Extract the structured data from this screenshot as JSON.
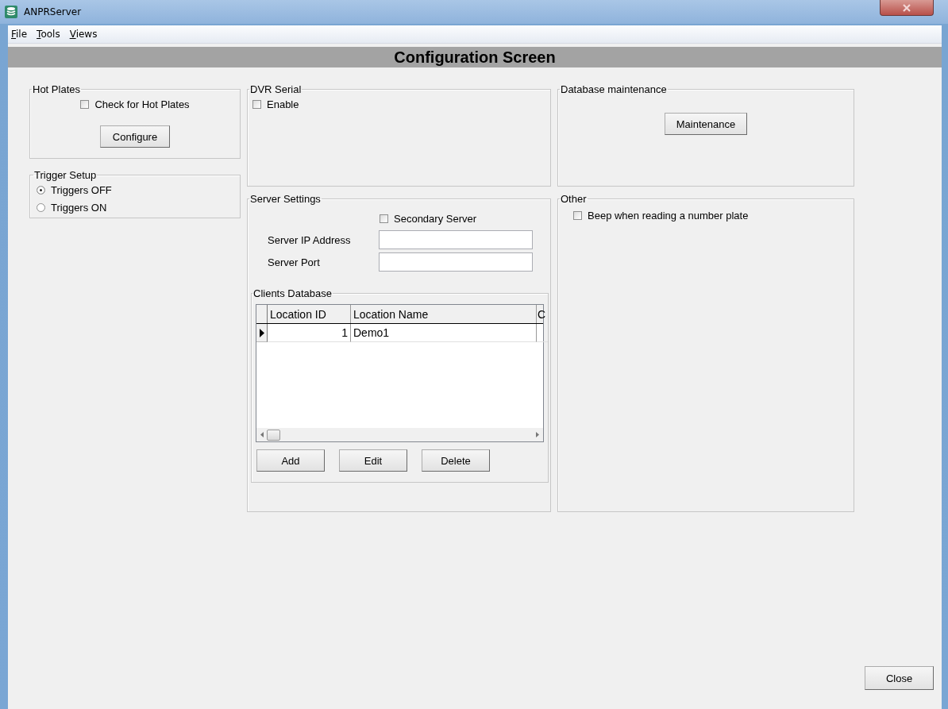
{
  "window": {
    "title": "ANPRServer"
  },
  "menu": [
    {
      "label": "File"
    },
    {
      "label": "Tools"
    },
    {
      "label": "Views"
    }
  ],
  "header": "Configuration Screen",
  "hot_plates": {
    "title": "Hot Plates",
    "check": {
      "label": "Check for Hot Plates",
      "checked": false
    },
    "button": "Configure"
  },
  "trigger_setup": {
    "title": "Trigger Setup",
    "options": [
      {
        "label": "Triggers OFF",
        "selected": true
      },
      {
        "label": "Triggers ON",
        "selected": false
      }
    ]
  },
  "dvr_serial": {
    "title": "DVR Serial",
    "check": {
      "label": "Enable",
      "checked": false
    }
  },
  "server_settings": {
    "title": "Server Settings",
    "check": {
      "label": "Secondary Server",
      "checked": false
    },
    "fields": [
      {
        "label": "Server IP Address"
      },
      {
        "label": "Server Port"
      }
    ],
    "clients_database": {
      "title": "Clients Database",
      "columns": [
        "Location ID",
        "Location Name",
        "C"
      ],
      "rows": [
        {
          "location_id": "1",
          "location_name": "Demo1",
          "selected": true
        }
      ],
      "buttons": [
        "Add",
        "Edit",
        "Delete"
      ]
    }
  },
  "database_maintenance": {
    "title": "Database maintenance",
    "button": "Maintenance"
  },
  "other": {
    "title": "Other",
    "check": {
      "label": "Beep when reading a number plate",
      "checked": false
    }
  },
  "close_button": "Close"
}
